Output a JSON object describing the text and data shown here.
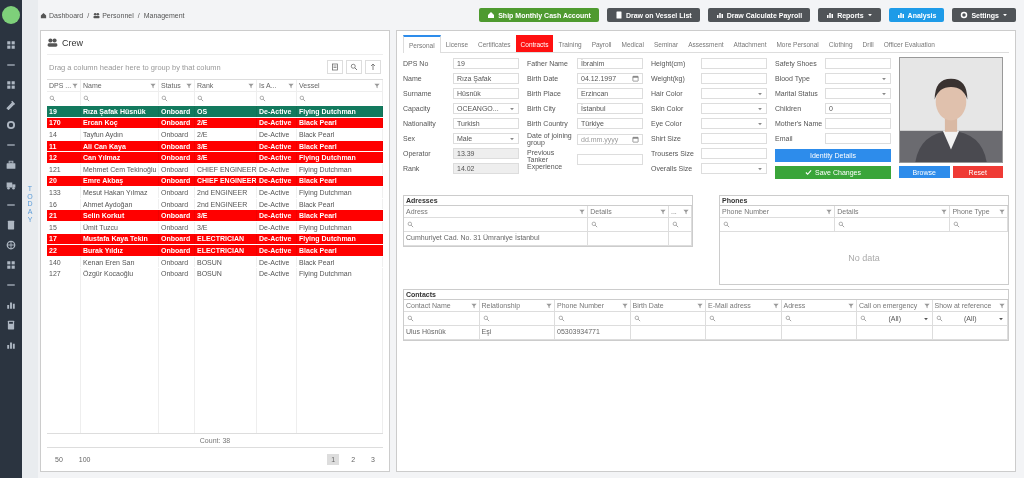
{
  "today_label": "TODAY",
  "breadcrumb": {
    "separator": "/",
    "items": [
      {
        "label": "Dashboard"
      },
      {
        "label": "Personnel"
      },
      {
        "label": "Management"
      }
    ]
  },
  "toolbar": [
    {
      "label": "Ship Monthly Cash Account",
      "color": "#4e9a2f",
      "caret": false
    },
    {
      "label": "Draw on Vessel List",
      "color": "#505458",
      "caret": false
    },
    {
      "label": "Draw Calculate Payroll",
      "color": "#505458",
      "caret": false
    },
    {
      "label": "Reports",
      "color": "#505458",
      "caret": true
    },
    {
      "label": "Analysis",
      "color": "#1e9be8",
      "caret": false
    },
    {
      "label": "Settings",
      "color": "#505458",
      "caret": true
    }
  ],
  "crew_panel": {
    "title": "Crew",
    "group_hint": "Drag a column header here to group by that column",
    "columns": [
      "DPS ...",
      "Name",
      "Status",
      "Rank",
      "Is A...",
      "Vessel"
    ],
    "rows": [
      {
        "cells": [
          "19",
          "Rıza Şafak Hüsnük",
          "Onboard",
          "OS",
          "De-Active",
          "Flying Dutchman"
        ],
        "color": "#137a5e"
      },
      {
        "cells": [
          "170",
          "Ercan Koç",
          "Onboard",
          "2/E",
          "De-Active",
          "Black Pearl"
        ],
        "color": "#ff0000"
      },
      {
        "cells": [
          "14",
          "Tayfun Aydın",
          "Onboard",
          "2/E",
          "De-Active",
          "Black Pearl"
        ],
        "color": "#ffffff"
      },
      {
        "cells": [
          "11",
          "Ali Can Kaya",
          "Onboard",
          "3/E",
          "De-Active",
          "Black Pearl"
        ],
        "color": "#ff0000"
      },
      {
        "cells": [
          "12",
          "Can Yılmaz",
          "Onboard",
          "3/E",
          "De-Active",
          "Flying Dutchman"
        ],
        "color": "#ff0000"
      },
      {
        "cells": [
          "121",
          "Mehmet Cem Tekinoğlu",
          "Onboard",
          "CHIEF ENGINEER",
          "De-Active",
          "Flying Dutchman"
        ],
        "color": "#ffffff"
      },
      {
        "cells": [
          "20",
          "Emre Akbaş",
          "Onboard",
          "CHIEF ENGINEER",
          "De-Active",
          "Black Pearl"
        ],
        "color": "#ff0000"
      },
      {
        "cells": [
          "133",
          "Mesut Hakan Yılmaz",
          "Onboard",
          "2nd ENGINEER",
          "De-Active",
          "Flying Dutchman"
        ],
        "color": "#ffffff"
      },
      {
        "cells": [
          "16",
          "Ahmet Aydoğan",
          "Onboard",
          "2nd ENGINEER",
          "De-Active",
          "Black Pearl"
        ],
        "color": "#ffffff"
      },
      {
        "cells": [
          "21",
          "Selin Korkut",
          "Onboard",
          "3/E",
          "De-Active",
          "Black Pearl"
        ],
        "color": "#ff0000"
      },
      {
        "cells": [
          "15",
          "Ümit Tuzcu",
          "Onboard",
          "3/E",
          "De-Active",
          "Flying Dutchman"
        ],
        "color": "#ffffff"
      },
      {
        "cells": [
          "17",
          "Mustafa Kaya Tekin",
          "Onboard",
          "ELECTRICIAN",
          "De-Active",
          "Flying Dutchman"
        ],
        "color": "#ff0000"
      },
      {
        "cells": [
          "22",
          "Burak Yıldız",
          "Onboard",
          "ELECTRICIAN",
          "De-Active",
          "Black Pearl"
        ],
        "color": "#ff0000"
      },
      {
        "cells": [
          "140",
          "Kenan Eren Sarı",
          "Onboard",
          "BOSUN",
          "De-Active",
          "Black Pearl"
        ],
        "color": "#ffffff"
      },
      {
        "cells": [
          "127",
          "Özgür Kocaoğlu",
          "Onboard",
          "BOSUN",
          "De-Active",
          "Flying Dutchman"
        ],
        "color": "#ffffff"
      }
    ],
    "count": "Count: 38",
    "page_sizes": [
      "50",
      "100"
    ],
    "pages": [
      {
        "label": "1",
        "selected": true
      },
      {
        "label": "2",
        "selected": false
      },
      {
        "label": "3",
        "selected": false
      }
    ]
  },
  "tabs": [
    {
      "label": "Personal",
      "selected": true,
      "alert": false
    },
    {
      "label": "License",
      "selected": false,
      "alert": false
    },
    {
      "label": "Certificates",
      "selected": false,
      "alert": false
    },
    {
      "label": "Contracts",
      "selected": false,
      "alert": true
    },
    {
      "label": "Training",
      "selected": false,
      "alert": false
    },
    {
      "label": "Payroll",
      "selected": false,
      "alert": false
    },
    {
      "label": "Medical",
      "selected": false,
      "alert": false
    },
    {
      "label": "Seminar",
      "selected": false,
      "alert": false
    },
    {
      "label": "Assessment",
      "selected": false,
      "alert": false
    },
    {
      "label": "Attachment",
      "selected": false,
      "alert": false
    },
    {
      "label": "More Personal",
      "selected": false,
      "alert": false
    },
    {
      "label": "Clothing",
      "selected": false,
      "alert": false
    },
    {
      "label": "Drill",
      "selected": false,
      "alert": false
    },
    {
      "label": "Officer Evaluation",
      "selected": false,
      "alert": false
    }
  ],
  "form_columns": [
    [
      {
        "label": "DPS No",
        "kind": "text",
        "value": "19"
      },
      {
        "label": "Name",
        "kind": "text",
        "value": "Rıza Şafak"
      },
      {
        "label": "Surname",
        "kind": "text",
        "value": "Hüsnük"
      },
      {
        "label": "Capacity",
        "kind": "select",
        "value": "OCEANGO..."
      },
      {
        "label": "Nationality",
        "kind": "text",
        "value": "Turkish"
      },
      {
        "label": "Sex",
        "kind": "select",
        "value": "Male"
      },
      {
        "label": "Operator",
        "kind": "readonly",
        "value": "13.39"
      },
      {
        "label": "Rank",
        "kind": "readonly",
        "value": "14.02"
      }
    ],
    [
      {
        "label": "Father Name",
        "kind": "text",
        "value": "İbrahim"
      },
      {
        "label": "Birth Date",
        "kind": "date",
        "value": "04.12.1997"
      },
      {
        "label": "Birth Place",
        "kind": "text",
        "value": "Erzincan"
      },
      {
        "label": "Birth City",
        "kind": "text",
        "value": "İstanbul"
      },
      {
        "label": "Birth Country",
        "kind": "text",
        "value": "Türkiye"
      },
      {
        "label": "Date of joining group",
        "kind": "date",
        "placeholder": "dd.mm.yyyy"
      },
      {
        "label": "Previous Tanker Experience",
        "kind": "text"
      }
    ],
    [
      {
        "label": "Height(cm)",
        "kind": "text"
      },
      {
        "label": "Weight(kg)",
        "kind": "text"
      },
      {
        "label": "Hair Color",
        "kind": "select"
      },
      {
        "label": "Skin Color",
        "kind": "select"
      },
      {
        "label": "Eye Color",
        "kind": "select"
      },
      {
        "label": "Shirt Size",
        "kind": "text"
      },
      {
        "label": "Trousers Size",
        "kind": "text"
      },
      {
        "label": "Overalls Size",
        "kind": "select"
      }
    ],
    [
      {
        "label": "Safety Shoes",
        "kind": "text"
      },
      {
        "label": "Blood Type",
        "kind": "select"
      },
      {
        "label": "Marital Status",
        "kind": "select"
      },
      {
        "label": "Children",
        "kind": "text",
        "value": "0"
      },
      {
        "label": "Mother's Name",
        "kind": "text"
      },
      {
        "label": "Email",
        "kind": "text"
      }
    ]
  ],
  "form_buttons": [
    {
      "label": "Identity Details",
      "color": "#2d8ceb",
      "icon": false
    },
    {
      "label": "Save Changes",
      "color": "#3aa53a",
      "icon": true
    }
  ],
  "photo": {
    "kind": "picture",
    "buttons": [
      {
        "label": "Browse",
        "color": "#2d8ceb"
      },
      {
        "label": "Reset",
        "color": "#ef3b35"
      }
    ]
  },
  "addresses": {
    "title": "Adresses",
    "columns": [
      "Adress",
      "Details",
      "..."
    ],
    "filters": [
      {
        "kind": "search"
      },
      {
        "kind": "search"
      },
      {
        "kind": "search"
      }
    ],
    "rows": [
      [
        "Cumhuriyet Cad. No. 31 Ümraniye İstanbul",
        "",
        ""
      ]
    ]
  },
  "phones": {
    "title": "Phones",
    "columns": [
      "Phone Number",
      "Details",
      "Phone Type"
    ],
    "filters": [
      {
        "kind": "search"
      },
      {
        "kind": "search"
      },
      {
        "kind": "search"
      }
    ],
    "empty": "No data"
  },
  "contacts": {
    "title": "Contacts",
    "columns": [
      "Contact Name",
      "Relationship",
      "Phone Number",
      "Birth Date",
      "E-Mail adress",
      "Adress",
      "Call on emergency",
      "Show at reference"
    ],
    "filters": [
      {
        "kind": "search"
      },
      {
        "kind": "search"
      },
      {
        "kind": "search"
      },
      {
        "kind": "search"
      },
      {
        "kind": "search"
      },
      {
        "kind": "search"
      },
      {
        "kind": "select",
        "value": "(All)"
      },
      {
        "kind": "select",
        "value": "(All)"
      }
    ],
    "rows": [
      [
        "Ulus Hüsnük",
        "Eşi",
        "05303934771",
        "",
        "",
        "",
        "",
        ""
      ]
    ]
  }
}
